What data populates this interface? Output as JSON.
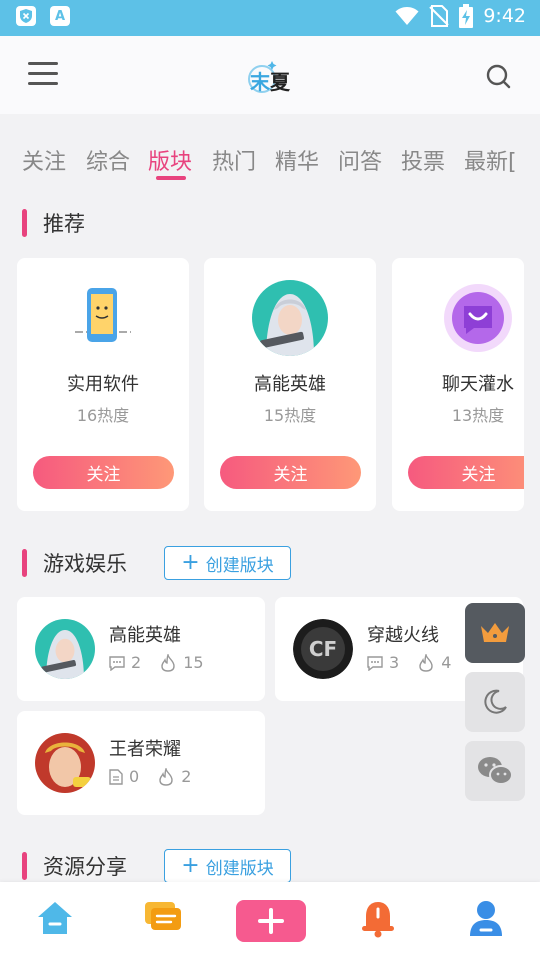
{
  "status_bar": {
    "time": "9:42",
    "icons": [
      "shield-icon",
      "a-icon",
      "wifi-icon",
      "no-sim-icon",
      "battery-charging-icon"
    ]
  },
  "header": {
    "logo_text_a": "末",
    "logo_text_b": "夏",
    "icons": [
      "menu-icon",
      "search-icon"
    ]
  },
  "tabs": [
    {
      "label": "关注"
    },
    {
      "label": "综合"
    },
    {
      "label": "版块",
      "active": true
    },
    {
      "label": "热门"
    },
    {
      "label": "精华"
    },
    {
      "label": "问答"
    },
    {
      "label": "投票"
    },
    {
      "label": "最新["
    }
  ],
  "recommend": {
    "title": "推荐",
    "cards": [
      {
        "name": "实用软件",
        "heat": "16热度",
        "follow": "关注"
      },
      {
        "name": "高能英雄",
        "heat": "15热度",
        "follow": "关注"
      },
      {
        "name": "聊天灌水",
        "heat": "13热度",
        "follow": "关注"
      }
    ]
  },
  "games_section": {
    "title": "游戏娱乐",
    "create_label": "创建版块",
    "items": [
      {
        "name": "高能英雄",
        "posts": "2",
        "heat": "15"
      },
      {
        "name": "穿越火线",
        "posts": "3",
        "heat": "4"
      },
      {
        "name": "王者荣耀",
        "posts": "0",
        "heat": "2"
      }
    ]
  },
  "resource_section": {
    "title": "资源分享",
    "create_label": "创建版块"
  },
  "floating": [
    "crown-icon",
    "moon-icon",
    "wechat-icon"
  ],
  "bottom_nav": [
    "home-icon",
    "chat-icon",
    "add-post-icon",
    "notification-icon",
    "profile-icon"
  ],
  "colors": {
    "accent": "#e8437e",
    "status_bar": "#5dc1e7",
    "link_blue": "#3aa0e0"
  }
}
